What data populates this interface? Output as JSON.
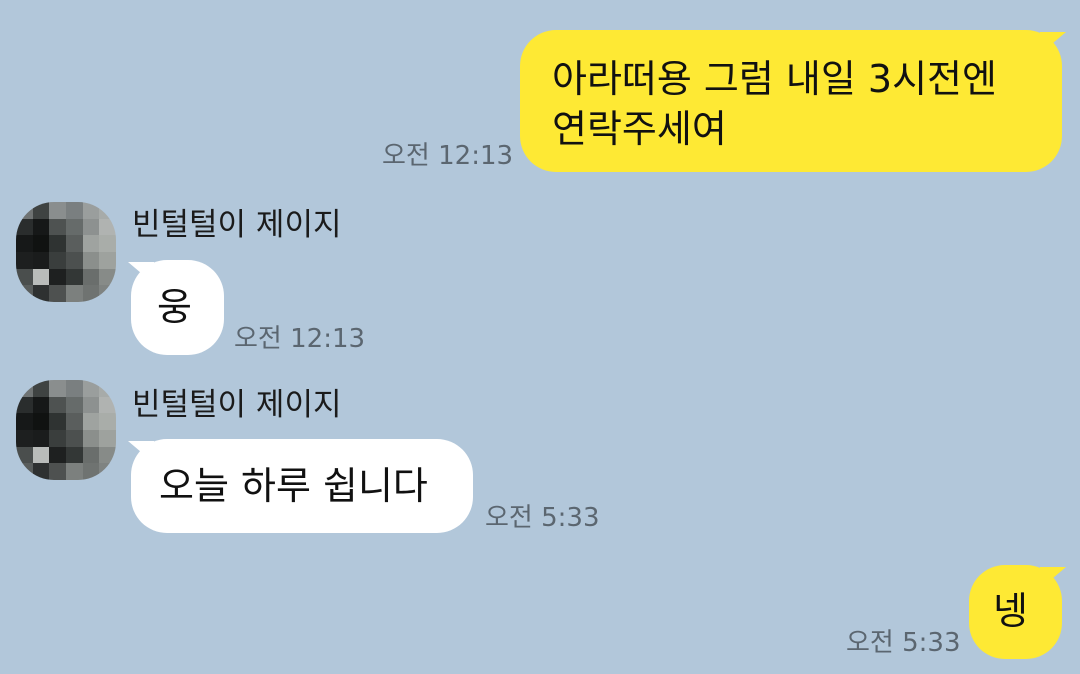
{
  "messages": [
    {
      "from": "me",
      "text_line1": "아라떠용 그럼 내일 3시전엔",
      "text_line2": "연락주세여",
      "time": "오전 12:13"
    },
    {
      "from": "other",
      "sender": "빈털털이 제이지",
      "text": "웅",
      "time": "오전 12:13"
    },
    {
      "from": "other",
      "sender": "빈털털이 제이지",
      "text": "오늘 하루 쉽니다",
      "time": "오전 5:33"
    },
    {
      "from": "me",
      "text": "넹",
      "time": "오전 5:33"
    }
  ],
  "colors": {
    "background": "#b2c7da",
    "my_bubble": "#fee934",
    "their_bubble": "#ffffff",
    "timestamp": "#5b6670"
  },
  "icons": {
    "avatar": "pixelated-profile-avatar"
  }
}
